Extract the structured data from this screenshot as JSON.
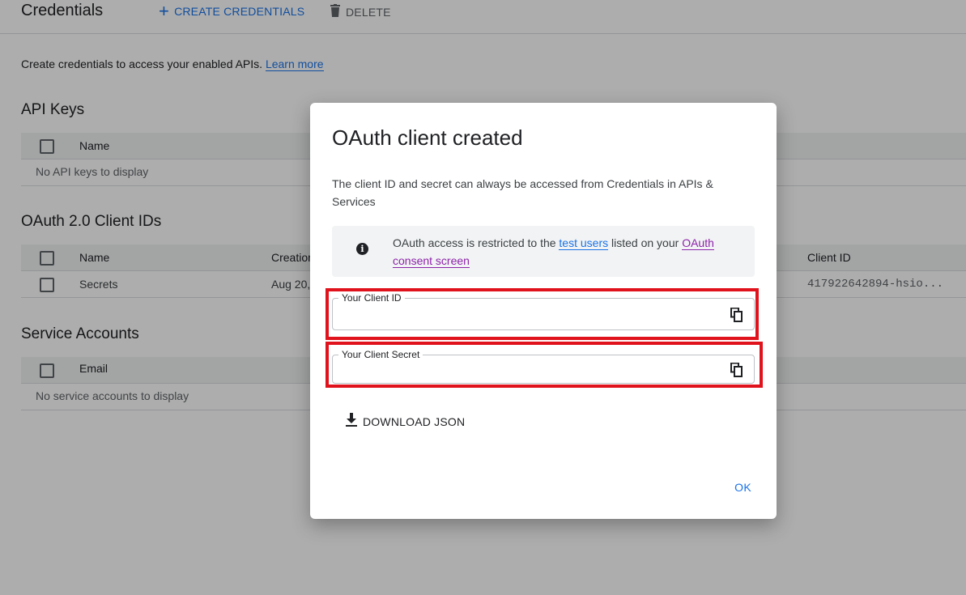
{
  "header": {
    "title": "Credentials",
    "create_label": "CREATE CREDENTIALS",
    "delete_label": "DELETE"
  },
  "intro": {
    "text": "Create credentials to access your enabled APIs.",
    "link": "Learn more"
  },
  "api_keys": {
    "title": "API Keys",
    "columns": [
      "Name"
    ],
    "empty": "No API keys to display"
  },
  "oauth": {
    "title": "OAuth 2.0 Client IDs",
    "columns": [
      "Name",
      "Creation",
      "Client ID"
    ],
    "rows": [
      {
        "name": "Secrets",
        "creation": "Aug 20,",
        "client_id": "417922642894-hsio..."
      }
    ]
  },
  "service_accounts": {
    "title": "Service Accounts",
    "columns": [
      "Email"
    ],
    "empty": "No service accounts to display"
  },
  "dialog": {
    "title": "OAuth client created",
    "description": "The client ID and secret can always be accessed from Credentials in APIs & Services",
    "notice": {
      "prefix": "OAuth access is restricted to the",
      "link1": "test users",
      "middle": "listed on your",
      "link2": "OAuth consent screen"
    },
    "client_id_label": "Your Client ID",
    "client_id_value": "",
    "client_secret_label": "Your Client Secret",
    "client_secret_value": "",
    "download_label": "DOWNLOAD JSON",
    "ok_label": "OK"
  },
  "colors": {
    "accent": "#1a73e8",
    "highlight": "#e0121c",
    "scrim": "rgba(0,0,0,0.32)",
    "link_visited": "#8e24aa"
  },
  "icons": {
    "create": "plus-icon",
    "delete": "trash-icon",
    "info": "info-icon",
    "copy": "copy-icon",
    "download": "download-icon"
  }
}
